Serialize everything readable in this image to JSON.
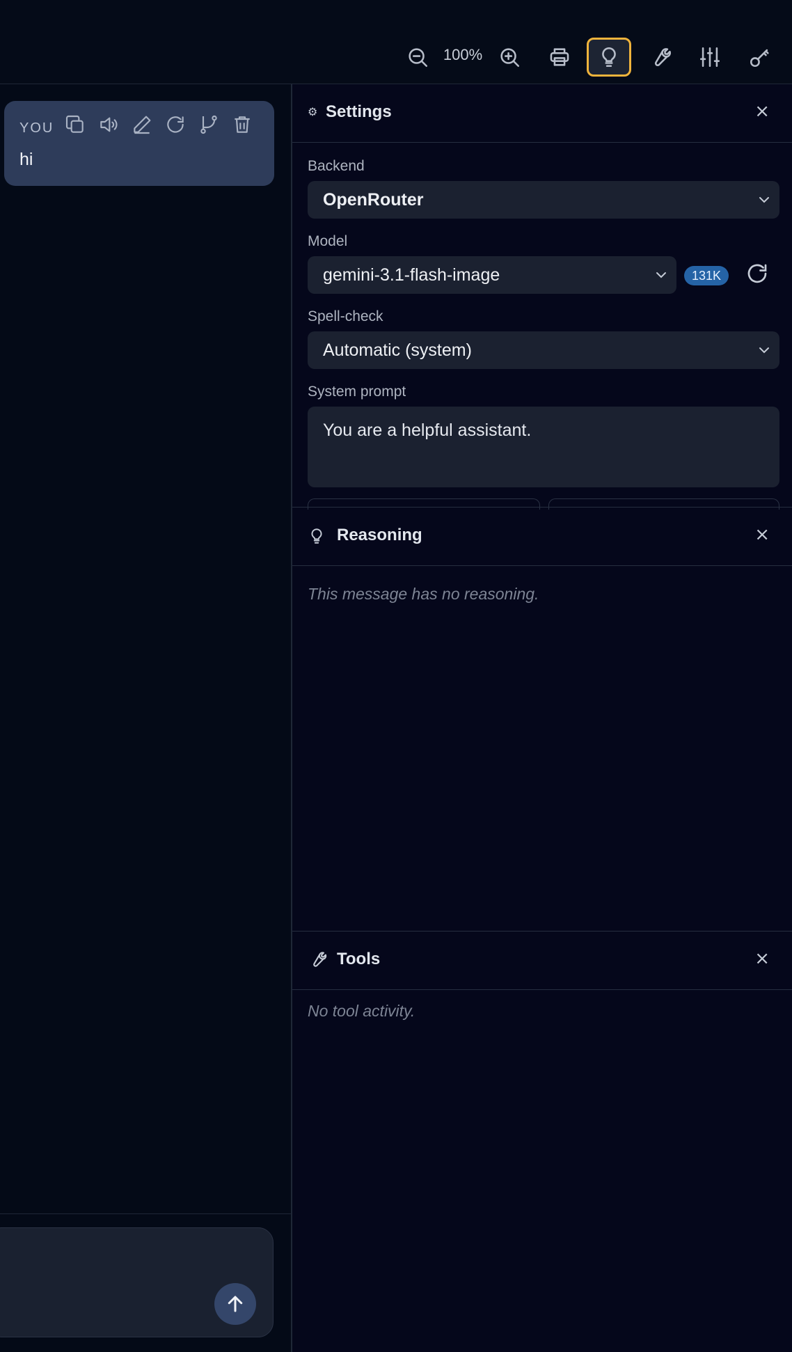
{
  "toolbar": {
    "zoom_level": "100%",
    "buttons": [
      "zoom-out-icon",
      "zoom-in-icon",
      "printer-icon",
      "lightbulb-icon",
      "wrench-icon",
      "sliders-icon",
      "key-icon"
    ],
    "active_button": "lightbulb-icon",
    "active_color": "#f0b43c"
  },
  "chat": {
    "message": {
      "author": "YOU",
      "text": "hi",
      "actions": [
        "copy-icon",
        "speaker-icon",
        "edit-icon",
        "regenerate-icon",
        "branch-icon",
        "trash-icon"
      ],
      "bubble_color": "#2e3c5a"
    },
    "send_icon": "arrow-up-icon"
  },
  "settings": {
    "title": "Settings",
    "close": "×",
    "backend_label": "Backend",
    "backend_value": "OpenRouter",
    "model_label": "Model",
    "model_value": "gemini-3.1-flash-image",
    "context_badge": "131K",
    "spellcheck_label": "Spell-check",
    "spellcheck_value": "Automatic (system)",
    "system_prompt_label": "System prompt",
    "system_prompt_value": "You are a helpful assistant."
  },
  "reasoning": {
    "title": "Reasoning",
    "close": "×",
    "empty": "This message has no reasoning."
  },
  "tools": {
    "title": "Tools",
    "close": "×",
    "empty": "No tool activity."
  },
  "colors": {
    "background": "#040a17",
    "panel_background": "#05071b",
    "badge": "#2563a6"
  }
}
